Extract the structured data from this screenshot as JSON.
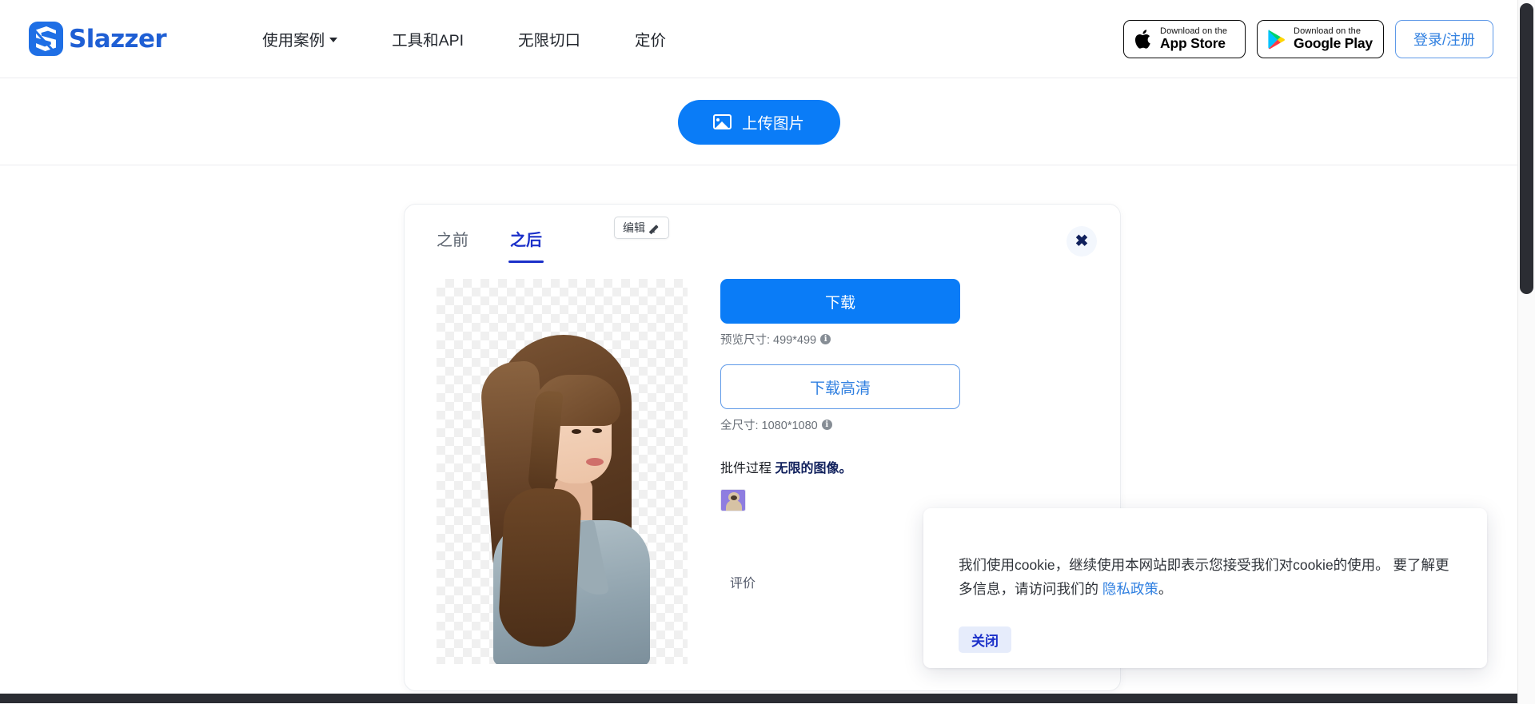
{
  "header": {
    "logo_text": "Slazzer",
    "logo_icon": "slazzer-logo-icon",
    "nav": [
      {
        "label": "使用案例",
        "has_caret": true
      },
      {
        "label": "工具和API",
        "has_caret": false
      },
      {
        "label": "无限切口",
        "has_caret": false
      },
      {
        "label": "定价",
        "has_caret": false
      }
    ],
    "app_store": {
      "top": "Download on the",
      "bottom": "App Store",
      "icon": "apple-icon"
    },
    "google_play": {
      "top": "Download on the",
      "bottom": "Google Play",
      "icon": "google-play-icon"
    },
    "login_label": "登录/注册"
  },
  "upload": {
    "button_label": "上传图片",
    "icon": "image-icon"
  },
  "card": {
    "tabs": [
      {
        "label": "之前",
        "active": false
      },
      {
        "label": "之后",
        "active": true
      }
    ],
    "close_icon": "close-icon",
    "edit_label": "编辑",
    "edit_icon": "pencil-icon",
    "download_label": "下载",
    "preview_size_label": "预览尺寸: 499*499",
    "download_hd_label": "下载高清",
    "full_size_label": "全尺寸: 1080*1080",
    "batch_text": "批件过程 ",
    "batch_bold": "无限的图像。",
    "rating_label": "评价",
    "info_icon_char": "i"
  },
  "cookie": {
    "text_before": "我们使用cookie，继续使用本网站即表示您接受我们对cookie的使用。 要了解更多信息，请访问我们的 ",
    "link_label": "隐私政策",
    "text_after": "。",
    "close_label": "关闭"
  },
  "colors": {
    "brand_blue": "#0a7cf7",
    "logo_blue": "#1f5fd4",
    "tab_active": "#1b30c9",
    "link_blue": "#2f7fe0",
    "scrollbar": "#2b2d33"
  }
}
